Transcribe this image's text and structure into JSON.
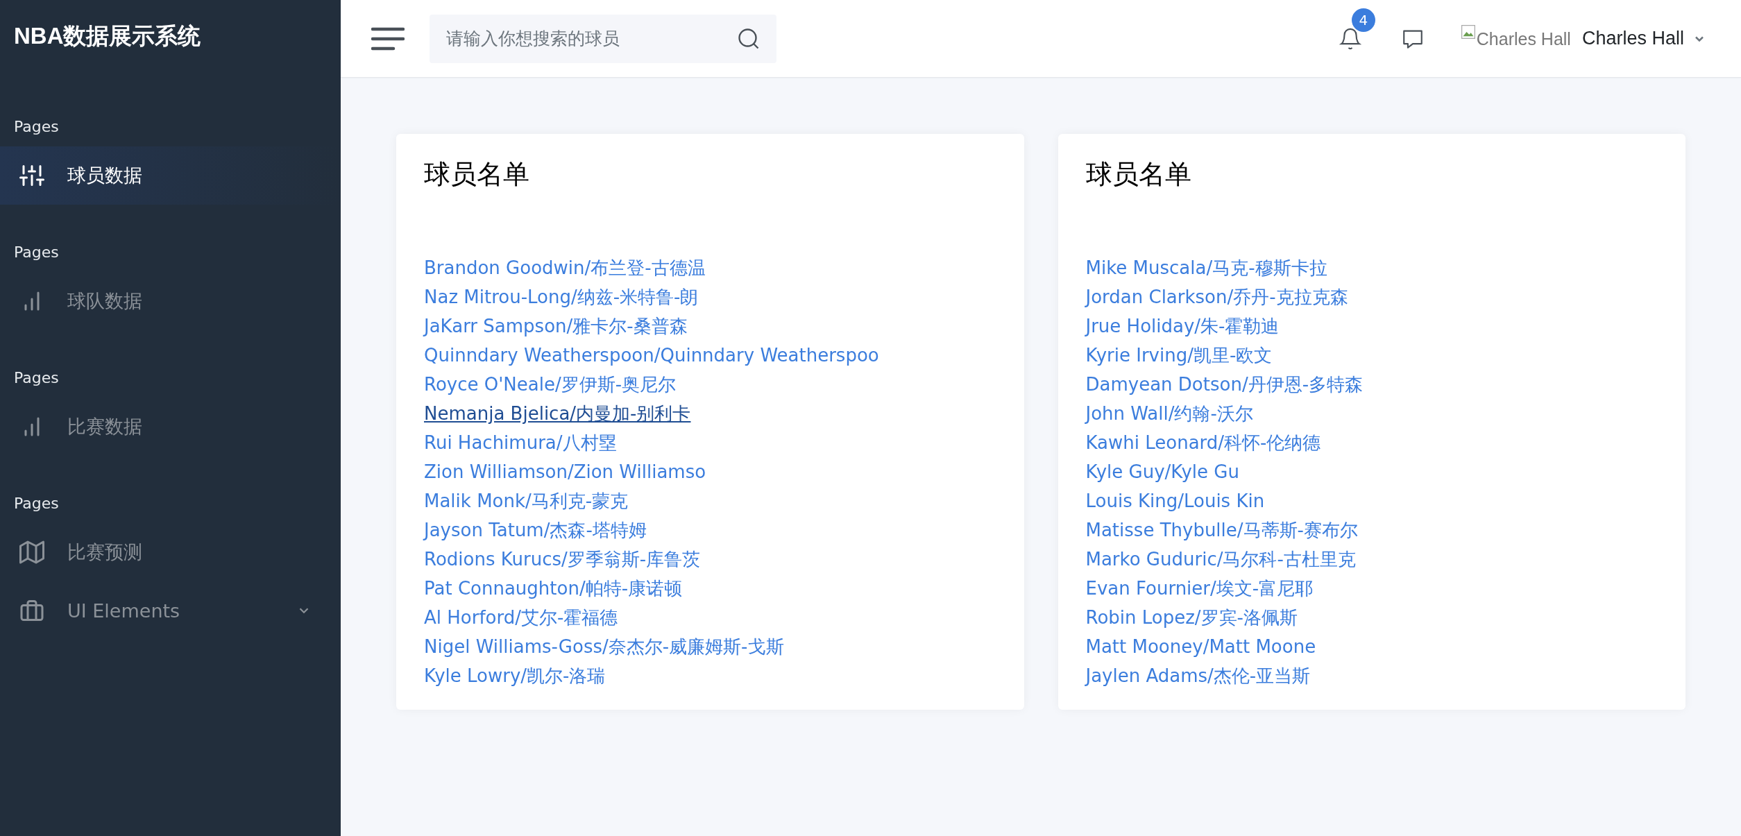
{
  "brand": "NBA数据展示系统",
  "sidebar": {
    "sections": [
      {
        "heading": "Pages",
        "items": [
          {
            "label": "球员数据",
            "selected": true,
            "kind": "link"
          }
        ]
      },
      {
        "heading": "Pages",
        "items": [
          {
            "label": "球队数据",
            "selected": false,
            "kind": "link"
          }
        ]
      },
      {
        "heading": "Pages",
        "items": [
          {
            "label": "比赛数据",
            "selected": false,
            "kind": "link"
          }
        ]
      },
      {
        "heading": "Pages",
        "items": [
          {
            "label": "比赛预测",
            "selected": false,
            "kind": "link"
          },
          {
            "label": "UI Elements",
            "selected": false,
            "kind": "dropdown"
          }
        ]
      }
    ]
  },
  "topbar": {
    "search": {
      "placeholder": "请输入你想搜索的球员"
    },
    "notifications": {
      "badge": "4"
    },
    "user": {
      "avatar_alt": "Charles Hall",
      "name": "Charles Hall"
    }
  },
  "cards": [
    {
      "title": "球员名单",
      "players": [
        {
          "name": "Brandon Goodwin/布兰登-古德温",
          "hovered": false
        },
        {
          "name": "Naz Mitrou-Long/纳兹-米特鲁-朗",
          "hovered": false
        },
        {
          "name": "JaKarr Sampson/雅卡尔-桑普森",
          "hovered": false
        },
        {
          "name": "Quinndary Weatherspoon/Quinndary Weatherspoo",
          "hovered": false
        },
        {
          "name": "Royce O'Neale/罗伊斯-奥尼尔",
          "hovered": false
        },
        {
          "name": "Nemanja Bjelica/内曼加-别利卡",
          "hovered": true
        },
        {
          "name": "Rui Hachimura/八村塁",
          "hovered": false
        },
        {
          "name": "Zion Williamson/Zion Williamso",
          "hovered": false
        },
        {
          "name": "Malik Monk/马利克-蒙克",
          "hovered": false
        },
        {
          "name": "Jayson Tatum/杰森-塔特姆",
          "hovered": false
        },
        {
          "name": "Rodions Kurucs/罗季翁斯-库鲁茨",
          "hovered": false
        },
        {
          "name": "Pat Connaughton/帕特-康诺顿",
          "hovered": false
        },
        {
          "name": "Al Horford/艾尔-霍福德",
          "hovered": false
        },
        {
          "name": "Nigel Williams-Goss/奈杰尔-威廉姆斯-戈斯",
          "hovered": false
        },
        {
          "name": "Kyle Lowry/凯尔-洛瑞",
          "hovered": false
        }
      ]
    },
    {
      "title": "球员名单",
      "players": [
        {
          "name": "Mike Muscala/马克-穆斯卡拉",
          "hovered": false
        },
        {
          "name": "Jordan Clarkson/乔丹-克拉克森",
          "hovered": false
        },
        {
          "name": "Jrue Holiday/朱-霍勒迪",
          "hovered": false
        },
        {
          "name": "Kyrie Irving/凯里-欧文",
          "hovered": false
        },
        {
          "name": "Damyean Dotson/丹伊恩-多特森",
          "hovered": false
        },
        {
          "name": "John Wall/约翰-沃尔",
          "hovered": false
        },
        {
          "name": "Kawhi Leonard/科怀-伦纳德",
          "hovered": false
        },
        {
          "name": "Kyle Guy/Kyle Gu",
          "hovered": false
        },
        {
          "name": "Louis King/Louis Kin",
          "hovered": false
        },
        {
          "name": "Matisse Thybulle/马蒂斯-赛布尔",
          "hovered": false
        },
        {
          "name": "Marko Guduric/马尔科-古杜里克",
          "hovered": false
        },
        {
          "name": "Evan Fournier/埃文-富尼耶",
          "hovered": false
        },
        {
          "name": "Robin Lopez/罗宾-洛佩斯",
          "hovered": false
        },
        {
          "name": "Matt Mooney/Matt Moone",
          "hovered": false
        },
        {
          "name": "Jaylen Adams/杰伦-亚当斯",
          "hovered": false
        }
      ]
    }
  ]
}
